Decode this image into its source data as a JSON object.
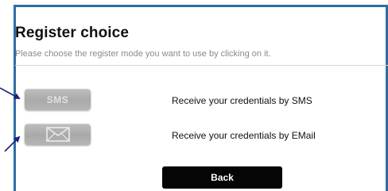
{
  "dialog": {
    "title": "Register choice",
    "subtitle": "Please choose the register mode you want to use by clicking on it."
  },
  "options": {
    "sms": {
      "button_label": "SMS",
      "description": "Receive your credentials by SMS"
    },
    "email": {
      "icon": "envelope-icon",
      "description": "Receive your credentials by EMail"
    }
  },
  "back_label": "Back",
  "colors": {
    "frame": "#2e6da4",
    "arrow": "#1a237e",
    "button_gray": "#b0b0b0",
    "back_button": "#050505"
  }
}
